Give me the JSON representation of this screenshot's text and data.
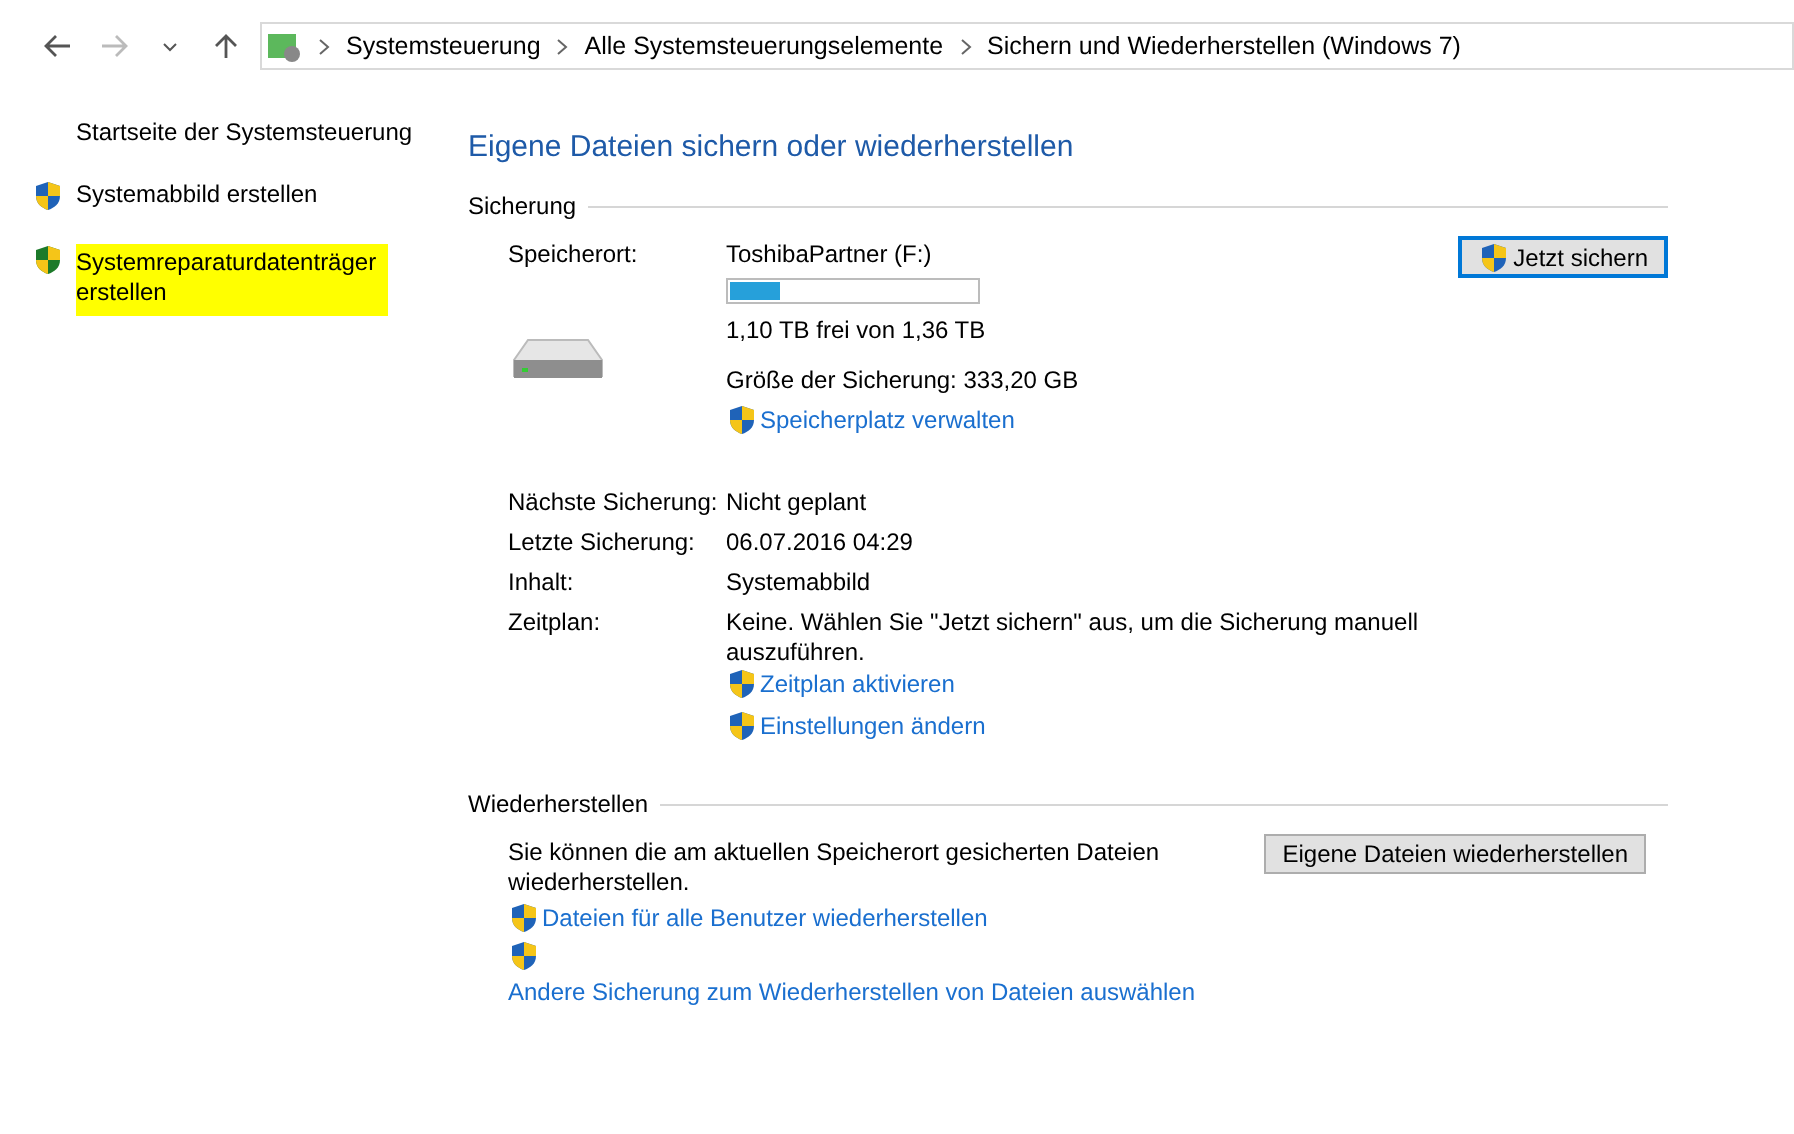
{
  "nav": {
    "breadcrumb": [
      "Systemsteuerung",
      "Alle Systemsteuerungselemente",
      "Sichern und Wiederherstellen (Windows 7)"
    ]
  },
  "sidebar": {
    "items": [
      {
        "label": "Startseite der Systemsteuerung",
        "kind": "link",
        "highlighted": false
      },
      {
        "label": "Systemabbild erstellen",
        "kind": "shield-link",
        "highlighted": false
      },
      {
        "label": "Systemreparaturdatenträger erstellen",
        "kind": "shield-link",
        "highlighted": true
      }
    ]
  },
  "title": "Eigene Dateien sichern oder wiederherstellen",
  "backup": {
    "heading": "Sicherung",
    "location_label": "Speicherort:",
    "drive_name": "ToshibaPartner (F:)",
    "drive_usage": {
      "level": 0.2
    },
    "free_text": "1,10 TB frei von 1,36 TB",
    "size_text": "Größe der Sicherung: 333,20 GB",
    "manage_link": "Speicherplatz verwalten",
    "backup_button": "Jetzt sichern",
    "details": [
      {
        "label": "Nächste Sicherung:",
        "value": "Nicht geplant"
      },
      {
        "label": "Letzte Sicherung:",
        "value": "06.07.2016 04:29"
      },
      {
        "label": "Inhalt:",
        "value": "Systemabbild"
      },
      {
        "label": "Zeitplan:",
        "value": "Keine. Wählen Sie \"Jetzt sichern\" aus, um die Sicherung manuell auszuführen."
      }
    ],
    "schedule_links": [
      "Zeitplan aktivieren",
      "Einstellungen ändern"
    ]
  },
  "restore": {
    "heading": "Wiederherstellen",
    "text": "Sie können die am aktuellen Speicherort gesicherten Dateien wiederherstellen.",
    "restore_button": "Eigene Dateien wiederherstellen",
    "links": [
      {
        "label": "Dateien für alle Benutzer wiederherstellen",
        "kind": "shield-inline"
      },
      {
        "label": "Andere Sicherung zum Wiederherstellen von Dateien auswählen",
        "kind": "shield-above"
      }
    ]
  }
}
